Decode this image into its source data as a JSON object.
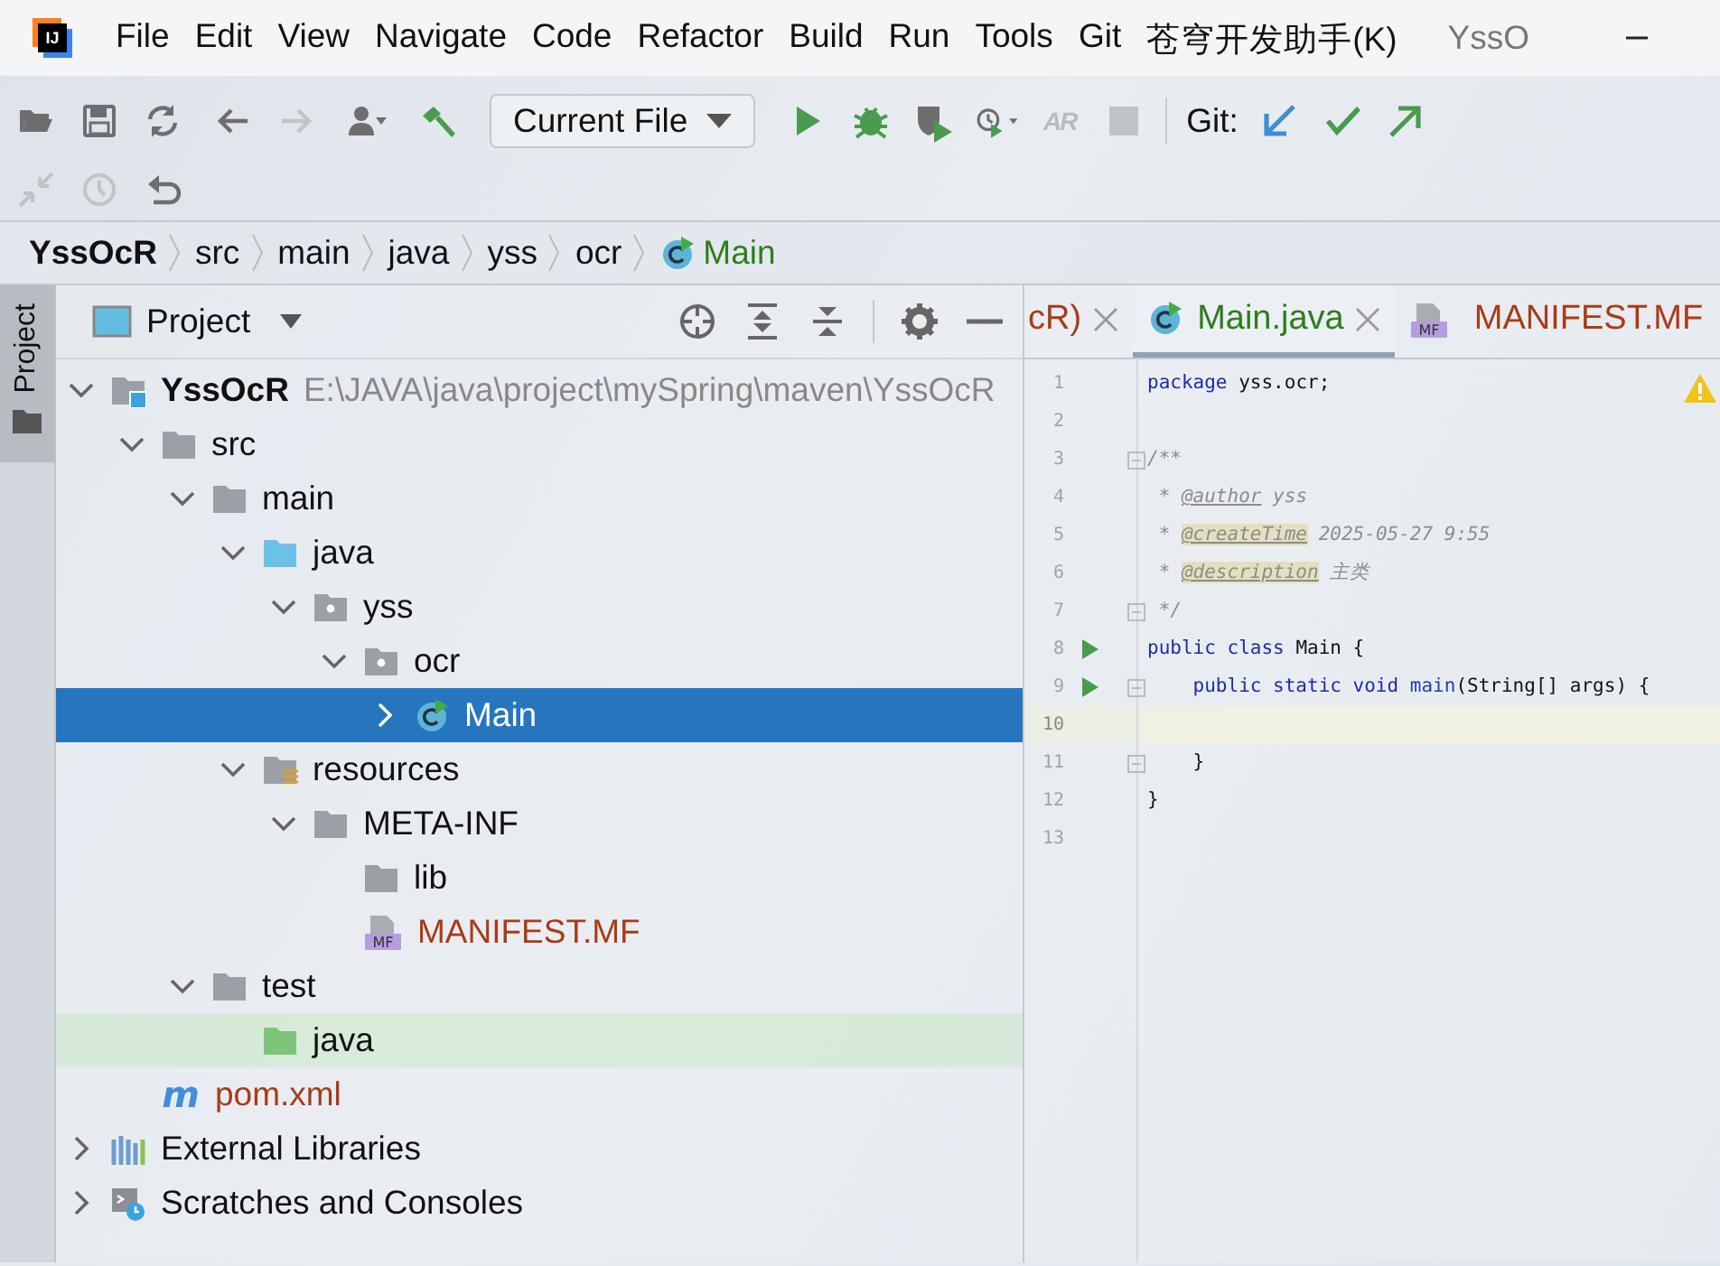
{
  "title_bar": {
    "logo": "IJ",
    "menus": [
      {
        "label": "File"
      },
      {
        "label": "Edit"
      },
      {
        "label": "View"
      },
      {
        "label": "Navigate"
      },
      {
        "label": "Code"
      },
      {
        "label": "Refactor"
      },
      {
        "label": "Build"
      },
      {
        "label": "Run"
      },
      {
        "label": "Tools"
      },
      {
        "label": "Git"
      },
      {
        "label": "苍穹开发助手(K)"
      }
    ],
    "window_title": "YssO"
  },
  "toolbar": {
    "rows": [
      [
        {
          "kind": "button",
          "disabled": false
        },
        {
          "kind": "button",
          "disabled": false
        },
        {
          "kind": "button",
          "disabled": false
        },
        {
          "kind": "button",
          "disabled": false
        },
        {
          "kind": "button",
          "disabled": true
        },
        {
          "kind": "button",
          "disabled": false
        },
        {
          "kind": "button",
          "disabled": false
        },
        {
          "kind": "dropdown",
          "label": "Current File"
        },
        {
          "kind": "button",
          "disabled": false
        },
        {
          "kind": "button",
          "disabled": false
        },
        {
          "kind": "button",
          "disabled": false
        },
        {
          "kind": "button",
          "disabled": false
        },
        {
          "kind": "glyph",
          "glyph": "AR",
          "disabled": true
        },
        {
          "kind": "button",
          "disabled": true
        },
        {
          "kind": "label",
          "label": "Git:"
        },
        {
          "kind": "button",
          "disabled": false
        },
        {
          "kind": "button",
          "disabled": false
        },
        {
          "kind": "button",
          "disabled": false
        }
      ],
      [
        {
          "kind": "button",
          "disabled": true
        },
        {
          "kind": "button",
          "disabled": true
        },
        {
          "kind": "button",
          "disabled": false
        }
      ]
    ]
  },
  "breadcrumb": [
    {
      "label": "YssOcR",
      "kind": "project"
    },
    {
      "label": "src",
      "kind": "folder"
    },
    {
      "label": "main",
      "kind": "folder"
    },
    {
      "label": "java",
      "kind": "folder"
    },
    {
      "label": "yss",
      "kind": "folder"
    },
    {
      "label": "ocr",
      "kind": "folder"
    },
    {
      "label": "Main",
      "kind": "class"
    }
  ],
  "tool_stripe": {
    "label": "Project",
    "selected": true
  },
  "project_panel": {
    "title": "Project",
    "tree": [
      {
        "label": "YssOcR",
        "hint": "E:\\JAVA\\java\\project\\mySpring\\maven\\YssOcR",
        "kind": "module",
        "expanded": true,
        "selected": false,
        "highlighted": false,
        "unversioned": false,
        "children": [
          {
            "label": "src",
            "kind": "folder",
            "expanded": true,
            "selected": false,
            "highlighted": false,
            "unversioned": false,
            "children": [
              {
                "label": "main",
                "kind": "folder",
                "expanded": true,
                "selected": false,
                "highlighted": false,
                "unversioned": false,
                "children": [
                  {
                    "label": "java",
                    "kind": "source-folder",
                    "expanded": true,
                    "selected": false,
                    "highlighted": false,
                    "unversioned": false,
                    "children": [
                      {
                        "label": "yss",
                        "kind": "package",
                        "expanded": true,
                        "selected": false,
                        "highlighted": false,
                        "unversioned": false,
                        "children": [
                          {
                            "label": "ocr",
                            "kind": "package",
                            "expanded": true,
                            "selected": false,
                            "highlighted": false,
                            "unversioned": false,
                            "children": [
                              {
                                "label": "Main",
                                "kind": "class",
                                "expanded": false,
                                "selected": true,
                                "highlighted": false,
                                "unversioned": false
                              }
                            ]
                          }
                        ]
                      }
                    ]
                  },
                  {
                    "label": "resources",
                    "kind": "resources-folder",
                    "expanded": true,
                    "selected": false,
                    "highlighted": false,
                    "unversioned": false,
                    "children": [
                      {
                        "label": "META-INF",
                        "kind": "folder",
                        "expanded": true,
                        "selected": false,
                        "highlighted": false,
                        "unversioned": false,
                        "children": [
                          {
                            "label": "lib",
                            "kind": "folder",
                            "selected": false,
                            "highlighted": false,
                            "unversioned": false
                          },
                          {
                            "label": "MANIFEST.MF",
                            "kind": "mf-file",
                            "badge": "MF",
                            "selected": false,
                            "highlighted": false,
                            "unversioned": true
                          }
                        ]
                      }
                    ]
                  }
                ]
              },
              {
                "label": "test",
                "kind": "folder",
                "expanded": true,
                "selected": false,
                "highlighted": false,
                "unversioned": false,
                "children": [
                  {
                    "label": "java",
                    "kind": "test-folder",
                    "selected": false,
                    "highlighted": true,
                    "unversioned": false
                  }
                ]
              }
            ]
          },
          {
            "label": "pom.xml",
            "kind": "maven",
            "badge": "m",
            "selected": false,
            "highlighted": false,
            "unversioned": true
          }
        ]
      },
      {
        "label": "External Libraries",
        "kind": "libraries",
        "expanded": false,
        "selected": false,
        "highlighted": false,
        "unversioned": false
      },
      {
        "label": "Scratches and Consoles",
        "kind": "scratches",
        "expanded": false,
        "selected": false,
        "highlighted": false,
        "unversioned": false
      }
    ]
  },
  "editor": {
    "tabs": [
      {
        "label": "cR)",
        "kind": "plain",
        "unversioned": true,
        "added": false,
        "selected": false,
        "closable": true
      },
      {
        "label": "Main.java",
        "kind": "class",
        "unversioned": false,
        "added": true,
        "selected": true,
        "closable": true
      },
      {
        "label": "MANIFEST.MF",
        "kind": "mf-file",
        "badge": "MF",
        "unversioned": true,
        "added": false,
        "selected": false,
        "closable": false
      }
    ],
    "warning": true,
    "lines": [
      {
        "number": "1",
        "run": false,
        "fold": false,
        "current": false,
        "tokens": [
          {
            "kind": "keyword",
            "text": "package"
          },
          {
            "kind": "plain",
            "text": " yss.ocr;"
          }
        ]
      },
      {
        "number": "2",
        "run": false,
        "fold": false,
        "current": false
      },
      {
        "number": "3",
        "run": false,
        "fold": true,
        "current": false,
        "tokens": [
          {
            "kind": "comment",
            "text": "/**"
          }
        ]
      },
      {
        "number": "4",
        "run": false,
        "fold": false,
        "current": false,
        "tokens": [
          {
            "kind": "comment",
            "text": " * "
          },
          {
            "kind": "doc-tag",
            "text": "@author"
          },
          {
            "kind": "comment",
            "text": " yss"
          }
        ]
      },
      {
        "number": "5",
        "run": false,
        "fold": false,
        "current": false,
        "tokens": [
          {
            "kind": "comment",
            "text": " * "
          },
          {
            "kind": "doc-tag-marked",
            "text": "@createTime"
          },
          {
            "kind": "comment",
            "text": " 2025-05-27 9:55"
          }
        ]
      },
      {
        "number": "6",
        "run": false,
        "fold": false,
        "current": false,
        "tokens": [
          {
            "kind": "comment",
            "text": " * "
          },
          {
            "kind": "doc-tag-marked",
            "text": "@description"
          },
          {
            "kind": "comment",
            "text": " 主类"
          }
        ]
      },
      {
        "number": "7",
        "run": false,
        "fold": true,
        "current": false,
        "tokens": [
          {
            "kind": "comment",
            "text": " */"
          }
        ]
      },
      {
        "number": "8",
        "run": true,
        "fold": false,
        "current": false,
        "tokens": [
          {
            "kind": "keyword",
            "text": "public class "
          },
          {
            "kind": "plain",
            "text": "Main {"
          }
        ]
      },
      {
        "number": "9",
        "run": true,
        "fold": true,
        "current": false,
        "tokens": [
          {
            "kind": "keyword",
            "text": "    public static void "
          },
          {
            "kind": "method",
            "text": "main"
          },
          {
            "kind": "plain",
            "text": "(String[] args) {"
          }
        ]
      },
      {
        "number": "10",
        "run": false,
        "fold": false,
        "current": true
      },
      {
        "number": "11",
        "run": false,
        "fold": true,
        "current": false,
        "tokens": [
          {
            "kind": "plain",
            "text": "    }"
          }
        ]
      },
      {
        "number": "12",
        "run": false,
        "fold": false,
        "current": false,
        "tokens": [
          {
            "kind": "plain",
            "text": "}"
          }
        ]
      },
      {
        "number": "13",
        "run": false,
        "fold": false,
        "current": false
      }
    ]
  }
}
